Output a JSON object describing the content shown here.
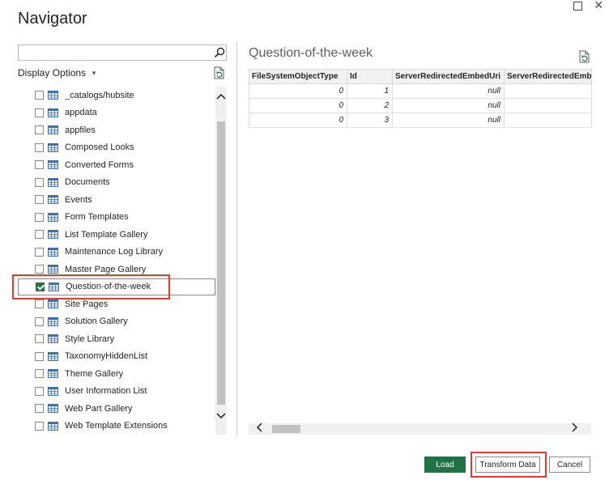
{
  "window": {
    "title": "Navigator"
  },
  "left_pane": {
    "search": {
      "value": "",
      "placeholder": ""
    },
    "display_options_label": "Display Options",
    "items": [
      {
        "label": "_catalogs/hubsite",
        "checked": false
      },
      {
        "label": "appdata",
        "checked": false
      },
      {
        "label": "appfiles",
        "checked": false
      },
      {
        "label": "Composed Looks",
        "checked": false
      },
      {
        "label": "Converted Forms",
        "checked": false
      },
      {
        "label": "Documents",
        "checked": false
      },
      {
        "label": "Events",
        "checked": false
      },
      {
        "label": "Form Templates",
        "checked": false
      },
      {
        "label": "List Template Gallery",
        "checked": false
      },
      {
        "label": "Maintenance Log Library",
        "checked": false
      },
      {
        "label": "Master Page Gallery",
        "checked": false
      },
      {
        "label": "Question-of-the-week",
        "checked": true
      },
      {
        "label": "Site Pages",
        "checked": false
      },
      {
        "label": "Solution Gallery",
        "checked": false
      },
      {
        "label": "Style Library",
        "checked": false
      },
      {
        "label": "TaxonomyHiddenList",
        "checked": false
      },
      {
        "label": "Theme Gallery",
        "checked": false
      },
      {
        "label": "User Information List",
        "checked": false
      },
      {
        "label": "Web Part Gallery",
        "checked": false
      },
      {
        "label": "Web Template Extensions",
        "checked": false
      }
    ]
  },
  "preview": {
    "title": "Question-of-the-week",
    "columns": [
      "FileSystemObjectType",
      "Id",
      "ServerRedirectedEmbedUri",
      "ServerRedirectedEmbedU"
    ],
    "rows": [
      [
        "0",
        "1",
        "null",
        ""
      ],
      [
        "0",
        "2",
        "null",
        ""
      ],
      [
        "0",
        "3",
        "null",
        ""
      ]
    ]
  },
  "buttons": {
    "load": "Load",
    "transform": "Transform Data",
    "cancel": "Cancel"
  },
  "colors": {
    "accent": "#217346",
    "highlight": "#e8392f"
  }
}
